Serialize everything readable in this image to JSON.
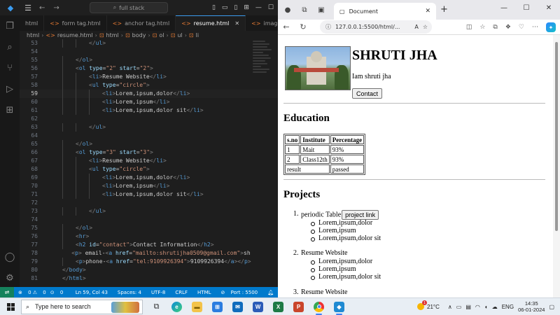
{
  "vscode": {
    "search": "full stack",
    "tabs": [
      {
        "label": "html",
        "active": false
      },
      {
        "label": "form tag.html",
        "active": false
      },
      {
        "label": "anchor tag.html",
        "active": false
      },
      {
        "label": "resume.html",
        "active": true
      },
      {
        "label": "imag",
        "active": false
      }
    ],
    "breadcrumb": [
      "html",
      "resume.html",
      "html",
      "body",
      "ol",
      "ul",
      "li"
    ],
    "status": {
      "errors": "0",
      "warnings": "0",
      "ports": "0",
      "position": "Ln 59, Col 43",
      "spaces": "Spaces: 4",
      "encoding": "UTF-8",
      "eol": "CRLF",
      "language": "HTML",
      "port": "Port : 5500"
    }
  },
  "browser": {
    "tab_title": "Document",
    "url": "127.0.0.1:5500/html/...",
    "page": {
      "name": "SHRUTI JHA",
      "bio": "Iam shruti jha",
      "contact_button": "Contact",
      "education_heading": "Education",
      "table": {
        "headers": [
          "s.no",
          "Institute",
          "Percentage"
        ],
        "rows": [
          [
            "1",
            "Mait",
            "93%"
          ],
          [
            "2",
            "Class12th",
            "93%"
          ]
        ],
        "footer": [
          "result",
          "passed"
        ]
      },
      "projects_heading": "Projects",
      "projects": [
        {
          "num": "1.",
          "title": "periodic Table",
          "button": "project link",
          "items": [
            "Lorem,ipsum,dolor",
            "Lorem,ipsum",
            "Lorem,ipsum,dolor sit"
          ]
        },
        {
          "num": "2.",
          "title": "Resume Website",
          "items": [
            "Lorem,ipsum,dolor",
            "Lorem,ipsum",
            "Lorem,ipsum,dolor sit"
          ]
        },
        {
          "num": "3.",
          "title": "Resume Website"
        }
      ]
    }
  },
  "taskbar": {
    "search_placeholder": "Type here to search",
    "weather": "21°C",
    "weather_badge": "1",
    "language": "ENG",
    "time": "14:35",
    "date": "06-01-2024"
  }
}
